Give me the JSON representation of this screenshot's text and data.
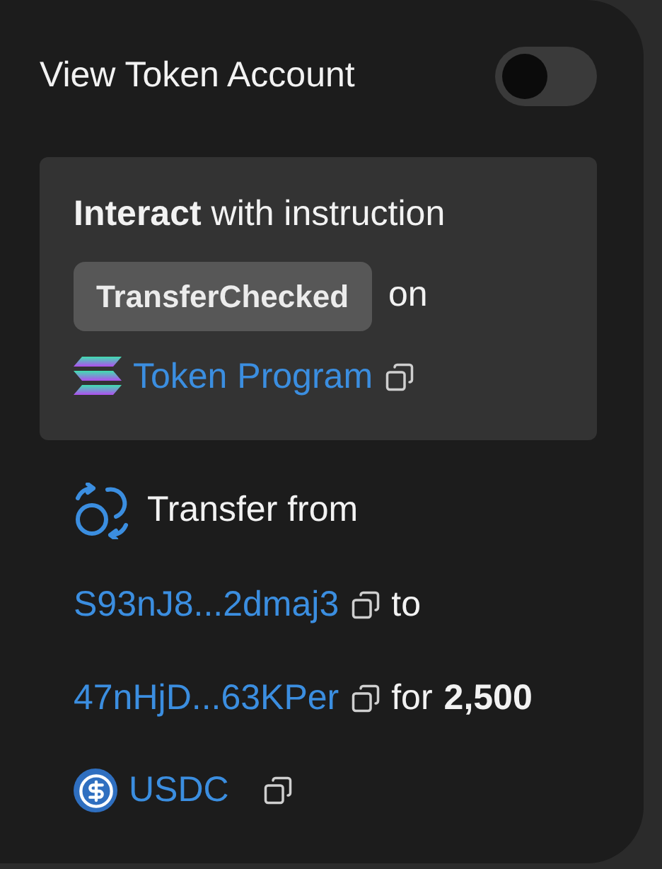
{
  "toggle": {
    "label": "View Token Account",
    "on": false
  },
  "instruction": {
    "sentence": "**Interact** with instruction",
    "name": "TransferChecked",
    "connector": "on",
    "program": "Token Program"
  },
  "transfer": {
    "heading": "Transfer from",
    "from": "S93nJ8...2dmaj3",
    "to_word": "to",
    "to": "47nHjD...63KPer",
    "for_word": "for",
    "amount": "2,500",
    "token": "USDC"
  }
}
